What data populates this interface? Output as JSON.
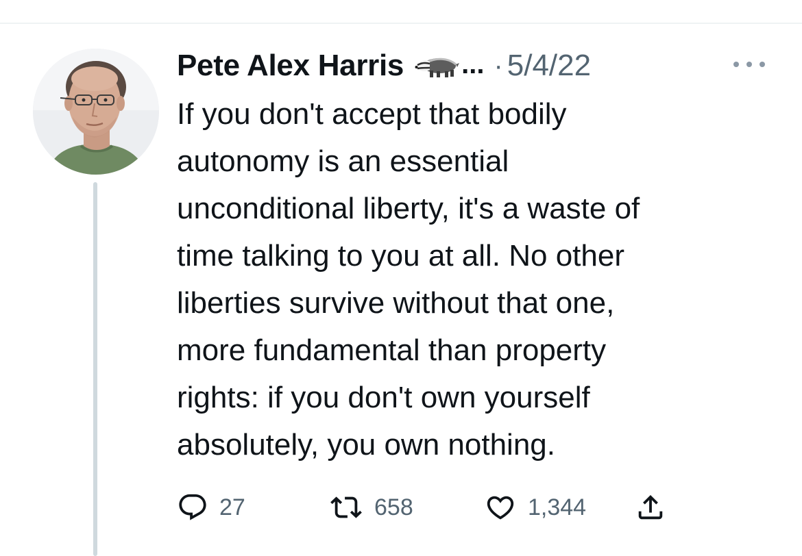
{
  "tweet": {
    "author": {
      "display_name": "Pete Alex Harris",
      "name_truncation": "...",
      "badge_icon": "badger-icon",
      "avatar_icon": "profile-photo-man-glasses"
    },
    "separator": "·",
    "date": "5/4/22",
    "more_icon": "more-horizontal-icon",
    "text": "If you don't accept that bodily\nautonomy is an essential\nunconditional liberty, it's a waste of\ntime talking to you at all. No other\nliberties survive without that one,\nmore fundamental than property\nrights: if you don't own yourself\nabsolutely, you own nothing.",
    "actions": {
      "reply": {
        "icon": "reply-icon",
        "count": "27"
      },
      "retweet": {
        "icon": "retweet-icon",
        "count": "658"
      },
      "like": {
        "icon": "heart-icon",
        "count": "1,344"
      },
      "share": {
        "icon": "share-icon"
      }
    }
  },
  "colors": {
    "text_primary": "#0f1419",
    "text_secondary": "#536471",
    "thread_line": "#cfd9de",
    "divider": "#eff3f4"
  }
}
